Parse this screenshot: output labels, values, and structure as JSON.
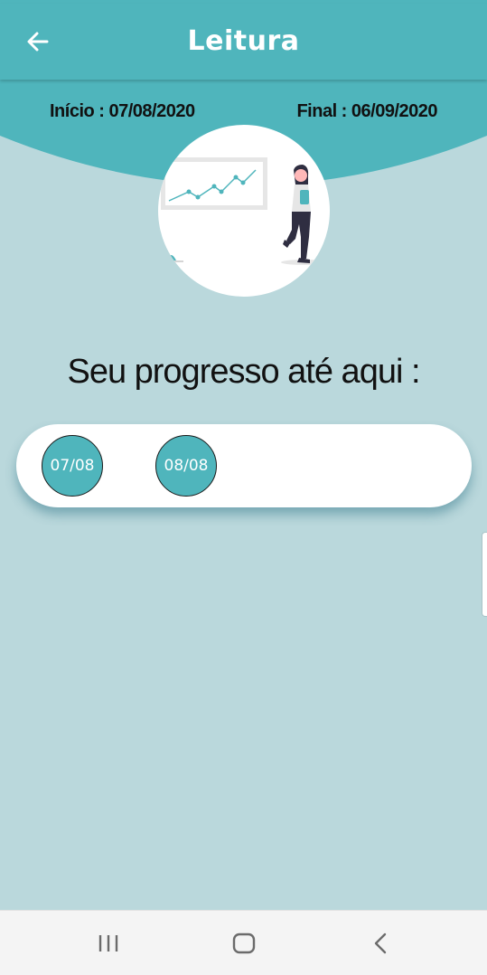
{
  "app_bar": {
    "title": "Leitura",
    "back_icon": "arrow-left-icon"
  },
  "period": {
    "start_label": "Início : 07/08/2020",
    "end_label": "Final : 06/09/2020"
  },
  "illustration": {
    "icon": "woman-presenting-chart-illustration"
  },
  "progress": {
    "title": "Seu progresso até aqui :",
    "days": [
      "07/08",
      "08/08"
    ]
  },
  "colors": {
    "accent": "#4fb5bc",
    "background": "#bad8dc",
    "card": "#ffffff",
    "nav_bar": "#f4f4f4"
  },
  "nav": {
    "recents_icon": "recents-icon",
    "home_icon": "home-icon",
    "back_icon": "back-chevron-icon"
  }
}
